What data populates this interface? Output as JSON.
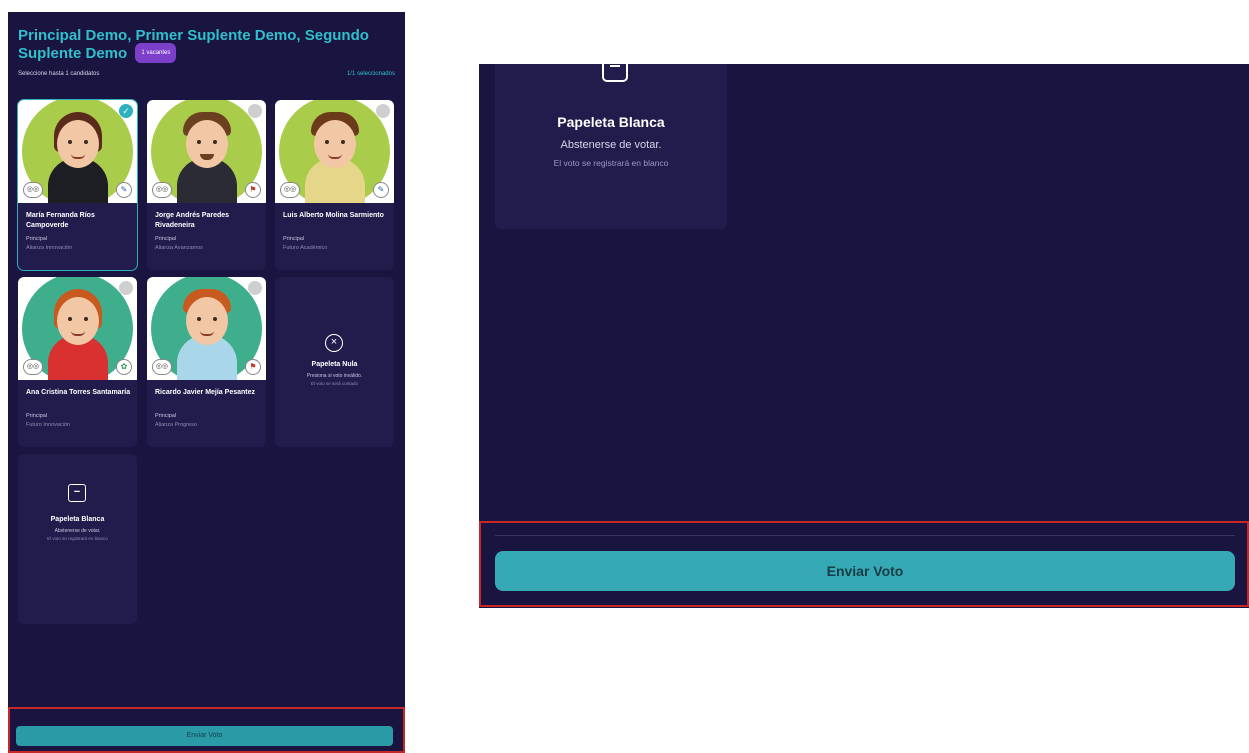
{
  "left": {
    "title": "Principal Demo, Primer Suplente Demo, Segundo Suplente Demo",
    "vacancies_badge": "1 vacantes",
    "instructions": "Seleccione hasta 1 candidatos",
    "selected_count": "1/1 seleccionados",
    "candidates": [
      {
        "name": "María Fernanda Ríos Campoverde",
        "role": "Principal",
        "party": "Alianza Innovación",
        "selected": true
      },
      {
        "name": "Jorge Andrés Paredes Rivadeneira",
        "role": "Principal",
        "party": "Alianza Avanzamos",
        "selected": false
      },
      {
        "name": "Luis Alberto Molina Sarmiento",
        "role": "Principal",
        "party": "Futuro Académico",
        "selected": false
      },
      {
        "name": "Ana Cristina Torres Santamaría",
        "role": "Principal",
        "party": "Futuro Innovación",
        "selected": false
      },
      {
        "name": "Ricardo Javier Mejía Pesantez",
        "role": "Principal",
        "party": "Alianza Progreso",
        "selected": false
      }
    ],
    "null_ballot": {
      "title": "Papeleta Nula",
      "desc": "Presiona si voto inválido.",
      "note": "El voto se será contado"
    },
    "blank_ballot": {
      "title": "Papeleta Blanca",
      "desc": "Abstenerse de votar.",
      "note": "El voto se registrará en blanco"
    },
    "send_button": "Enviar Voto"
  },
  "right": {
    "blank_ballot": {
      "title": "Papeleta Blanca",
      "desc": "Abstenerse de votar.",
      "note": "El voto se registrará en blanco"
    },
    "send_button": "Enviar Voto"
  },
  "colors": {
    "background": "#1a1440",
    "card": "#221c4d",
    "accent": "#2fc0cc",
    "highlight_border": "#c62828"
  }
}
